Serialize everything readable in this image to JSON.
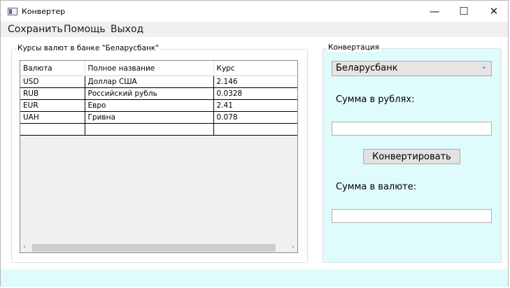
{
  "window": {
    "title": "Конвертер",
    "controls": {
      "minimize": "—",
      "maximize": "☐",
      "close": "✕"
    }
  },
  "menu": {
    "items": [
      "Сохранить",
      "Помощь",
      "Выход"
    ]
  },
  "rates_group": {
    "label": "Курсы валют в банке \"Беларусбанк\"",
    "columns": [
      "Валюта",
      "Полное название",
      "Курс"
    ],
    "rows": [
      [
        "USD",
        "Доллар США",
        "2.146"
      ],
      [
        "RUB",
        "Российский рубль",
        "0.0328"
      ],
      [
        "EUR",
        "Евро",
        "2.41"
      ],
      [
        "UAH",
        "Гривна",
        "0.078"
      ],
      [
        "",
        "",
        ""
      ]
    ]
  },
  "conversion": {
    "label": "Конвертация",
    "bank_select": "Беларусбанк",
    "sum_rubles_label": "Сумма в рублях:",
    "sum_rubles_value": "",
    "convert_button": "Конвертировать",
    "sum_currency_label": "Сумма в валюте:",
    "sum_currency_value": ""
  },
  "colors": {
    "panel_bg": "#e0fbfb",
    "menubar_bg": "#f0f0f0",
    "grid_bg": "#f0f0f0"
  },
  "icons": {
    "app": "window-app-icon",
    "combo": "chevron-down-icon",
    "scroll_left": "chevron-left-icon",
    "scroll_right": "chevron-right-icon"
  }
}
